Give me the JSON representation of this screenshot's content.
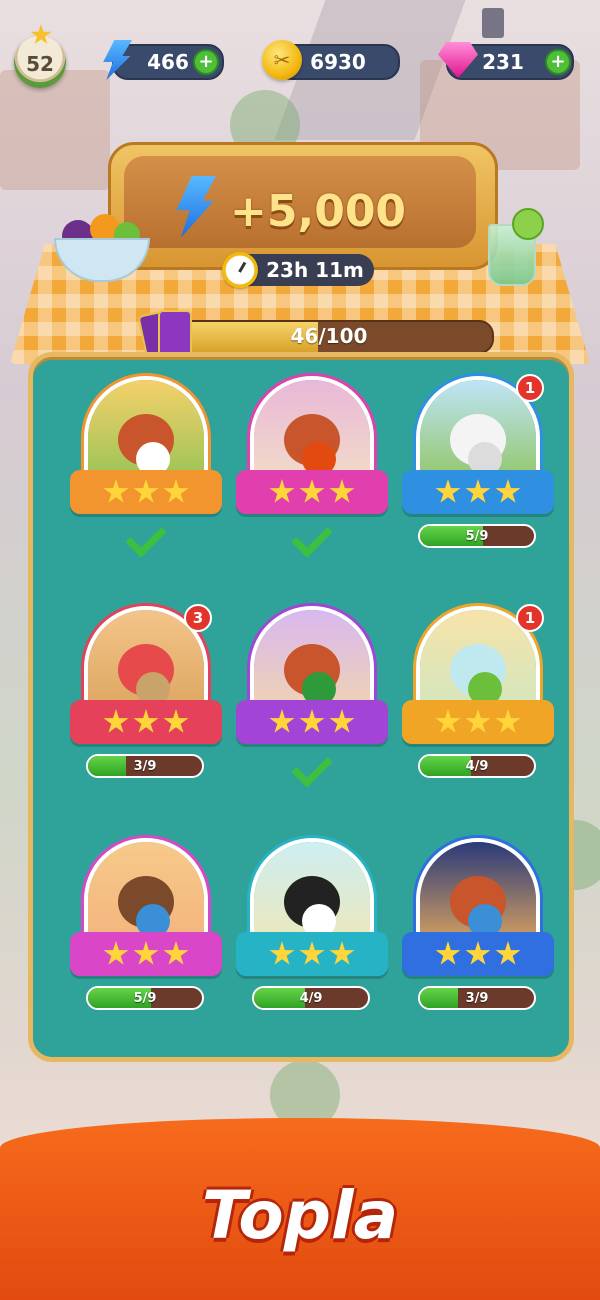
{
  "resources": {
    "level": "52",
    "energy": "466",
    "coins": "6930",
    "gems": "231",
    "plus": "+"
  },
  "event": {
    "reward": "+5,000",
    "timer": "23h 11m",
    "progress_text": "46/100",
    "progress_fraction": 0.46
  },
  "colors": {
    "board": "#2fa29a",
    "banner": "#f76b1c",
    "progress_green": "#2fa323",
    "badge_red": "#e2342a"
  },
  "cards": [
    {
      "subject": "red panda with flowers",
      "ribbon_color": "#f3952e",
      "stars": 3,
      "status": "completed",
      "progress": "",
      "badge": ""
    },
    {
      "subject": "red panda with laundry",
      "ribbon_color": "#e23fae",
      "stars": 3,
      "status": "completed",
      "progress": "",
      "badge": ""
    },
    {
      "subject": "sheep in meadow",
      "ribbon_color": "#2f8fe0",
      "stars": 3,
      "status": "in-progress",
      "progress": "5/9",
      "progress_fraction": 0.556,
      "badge": "1"
    },
    {
      "subject": "picnic basket",
      "ribbon_color": "#e5415a",
      "stars": 3,
      "status": "in-progress",
      "progress": "3/9",
      "progress_fraction": 0.333,
      "badge": "3"
    },
    {
      "subject": "red panda in leprechaun hat",
      "ribbon_color": "#a245d6",
      "stars": 3,
      "status": "completed",
      "progress": "",
      "badge": ""
    },
    {
      "subject": "mojito glass",
      "ribbon_color": "#f0a526",
      "stars": 3,
      "status": "in-progress",
      "progress": "4/9",
      "progress_fraction": 0.444,
      "badge": "1"
    },
    {
      "subject": "woman playing guitar",
      "ribbon_color": "#d946c7",
      "stars": 3,
      "status": "in-progress",
      "progress": "5/9",
      "progress_fraction": 0.556,
      "badge": ""
    },
    {
      "subject": "panda",
      "ribbon_color": "#27b3c6",
      "stars": 3,
      "status": "in-progress",
      "progress": "4/9",
      "progress_fraction": 0.444,
      "badge": ""
    },
    {
      "subject": "woman at night market",
      "ribbon_color": "#2f6fe0",
      "stars": 3,
      "status": "in-progress",
      "progress": "3/9",
      "progress_fraction": 0.333,
      "badge": ""
    }
  ],
  "cta": {
    "label": "Topla"
  }
}
